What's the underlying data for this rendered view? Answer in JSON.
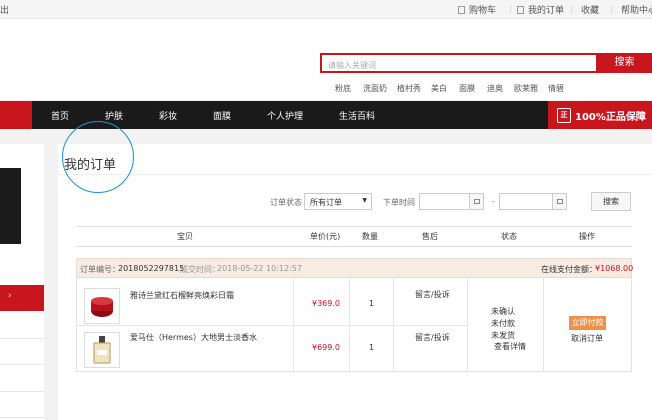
{
  "topbar": {
    "logout_fragment": "出",
    "cart": "购物车",
    "my_orders": "我的订单",
    "favorites": "收藏",
    "help": "帮助中心"
  },
  "search": {
    "placeholder": "请输入关键词",
    "button": "搜索",
    "hot_keywords": [
      "粉底",
      "洗面奶",
      "植村秀",
      "美白",
      "面膜",
      "迪奥",
      "欧莱雅",
      "倩碧"
    ]
  },
  "nav": {
    "items": [
      "首页",
      "护肤",
      "彩妆",
      "面膜",
      "个人护理",
      "生活百科"
    ],
    "guarantee_badge": "正",
    "guarantee": "100%正品保障"
  },
  "sidebar": {
    "active_glyph": "›"
  },
  "page": {
    "title": "我的订单"
  },
  "filters": {
    "status_label": "订单状态",
    "status_value": "所有订单",
    "time_label": "下单时间",
    "dash": "-",
    "query_button": "搜索"
  },
  "table": {
    "columns": [
      "宝贝",
      "单价(元)",
      "数量",
      "售后",
      "状态",
      "操作"
    ]
  },
  "order": {
    "number_label": "订单编号：",
    "number": "2018052297815",
    "time_label": "成交时间：",
    "time": "2018-05-22 10:12:57",
    "total_label": "在线支付金额：",
    "total": "¥1068.00",
    "items": [
      {
        "name": "雅诗兰黛红石榴鲜亮焕彩日霜",
        "price": "¥369.0",
        "qty": "1",
        "after_sale": "留言/投诉"
      },
      {
        "name": "爱马仕（Hermes）大地男士淡香水",
        "price": "¥699.0",
        "qty": "1",
        "after_sale": "留言/投诉"
      }
    ],
    "status_lines": [
      "未确认",
      "未付款",
      "未发货",
      "查看详情"
    ],
    "pay_button": "立即付款",
    "cancel": "取消订单"
  },
  "colors": {
    "brand_red": "#c9151e",
    "nav_dark": "#1a1a1a",
    "pay_orange": "#f0914a",
    "highlight_circle": "#1e90d6"
  }
}
